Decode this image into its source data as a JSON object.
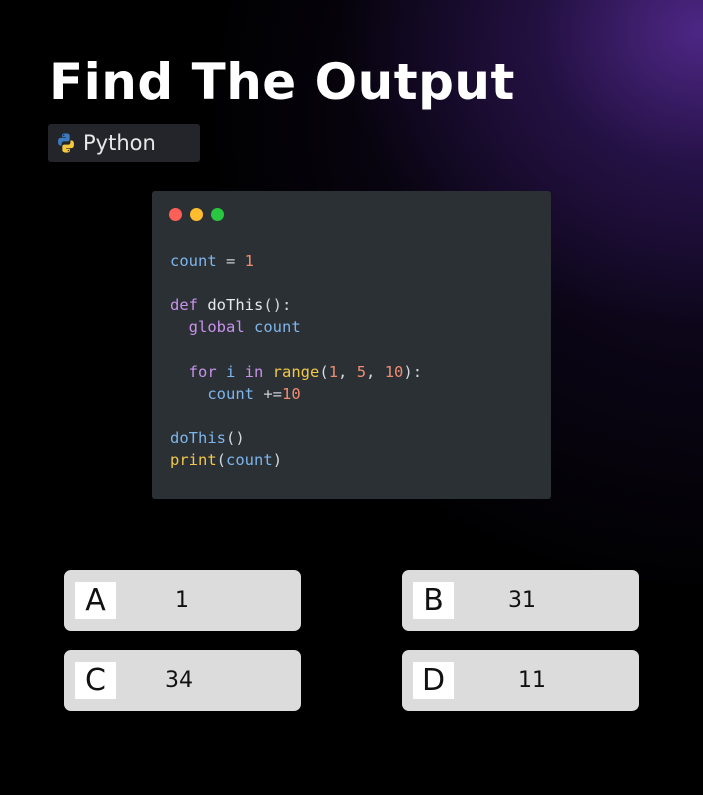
{
  "title": "Find The Output",
  "language_badge": {
    "label": "Python",
    "icon": "python-logo-icon"
  },
  "code_window": {
    "controls": [
      "close-dot",
      "minimize-dot",
      "maximize-dot"
    ],
    "colors": {
      "background": "#2b3035",
      "variable": "#7db6ec",
      "number": "#f08d71",
      "keyword": "#c792ea",
      "builtin": "#f2c84b"
    },
    "tokens": {
      "l1_var": "count",
      "l1_op": " = ",
      "l1_num": "1",
      "l2_kw": "def ",
      "l2_fn": "doThis",
      "l2_punc": "():",
      "l3_indent": "  ",
      "l3_kw": "global ",
      "l3_var": "count",
      "l4_indent": "  ",
      "l4_kw1": "for ",
      "l4_i": "i ",
      "l4_kw2": "in ",
      "l4_fn": "range",
      "l4_p1": "(",
      "l4_n1": "1",
      "l4_c1": ", ",
      "l4_n2": "5",
      "l4_c2": ", ",
      "l4_n3": "10",
      "l4_p2": "):",
      "l5_indent": "    ",
      "l5_var": "count ",
      "l5_op": "+=",
      "l5_num": "10",
      "l6_call": "doThis",
      "l6_punc": "()",
      "l7_fn": "print",
      "l7_p1": "(",
      "l7_var": "count",
      "l7_p2": ")"
    }
  },
  "options": [
    {
      "letter": "A",
      "value": "1"
    },
    {
      "letter": "B",
      "value": "31"
    },
    {
      "letter": "C",
      "value": "34"
    },
    {
      "letter": "D",
      "value": "11"
    }
  ]
}
